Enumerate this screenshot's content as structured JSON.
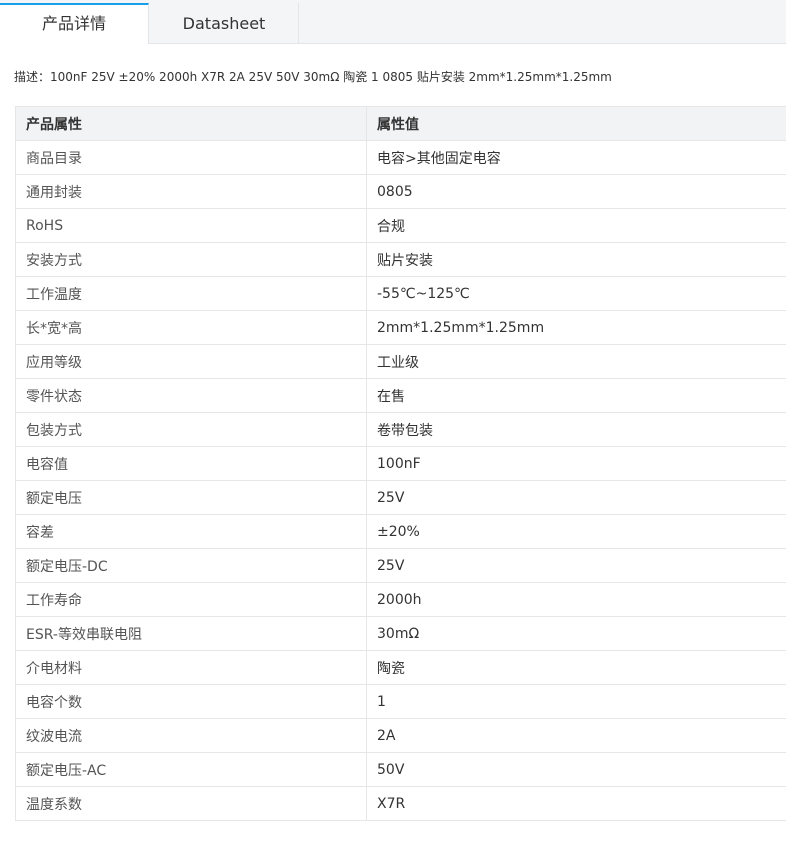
{
  "tabs": [
    {
      "label": "产品详情"
    },
    {
      "label": "Datasheet"
    }
  ],
  "description": "描述：100nF 25V ±20% 2000h X7R 2A 25V 50V 30mΩ 陶瓷 1 0805 贴片安装 2mm*1.25mm*1.25mm",
  "table": {
    "headers": [
      "产品属性",
      "属性值"
    ],
    "rows": [
      {
        "key": "商品目录",
        "value": "电容>其他固定电容"
      },
      {
        "key": "通用封装",
        "value": "0805"
      },
      {
        "key": "RoHS",
        "value": "合规"
      },
      {
        "key": "安装方式",
        "value": "贴片安装"
      },
      {
        "key": "工作温度",
        "value": "-55℃~125℃"
      },
      {
        "key": "长*宽*高",
        "value": "2mm*1.25mm*1.25mm"
      },
      {
        "key": "应用等级",
        "value": "工业级"
      },
      {
        "key": "零件状态",
        "value": "在售"
      },
      {
        "key": "包装方式",
        "value": "卷带包装"
      },
      {
        "key": "电容值",
        "value": "100nF"
      },
      {
        "key": "额定电压",
        "value": "25V"
      },
      {
        "key": "容差",
        "value": "±20%"
      },
      {
        "key": "额定电压-DC",
        "value": "25V"
      },
      {
        "key": "工作寿命",
        "value": "2000h"
      },
      {
        "key": "ESR-等效串联电阻",
        "value": "30mΩ"
      },
      {
        "key": "介电材料",
        "value": "陶瓷"
      },
      {
        "key": "电容个数",
        "value": "1"
      },
      {
        "key": "纹波电流",
        "value": "2A"
      },
      {
        "key": "额定电压-AC",
        "value": "50V"
      },
      {
        "key": "温度系数",
        "value": "X7R"
      }
    ]
  },
  "colors": {
    "active_tab_accent": "#199fe9",
    "tabbar_bg": "#f4f5f7",
    "header_bg": "#f2f3f5",
    "border": "#e6e6e6"
  }
}
